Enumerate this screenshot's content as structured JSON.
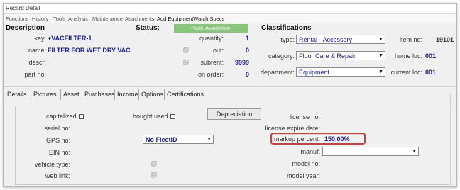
{
  "window": {
    "title": "Record Detail"
  },
  "menu": [
    "Functions",
    "History",
    "Tools",
    "Analysis",
    "Maintenance",
    "Attachments",
    "Add EquipmentWatch Specs"
  ],
  "description": {
    "section_title": "Description",
    "key_label": "key:",
    "key_value": "+VACFILTER-1",
    "name_label": "name:",
    "name_value": "FILTER FOR WET DRY VAC",
    "descr_label": "descr:",
    "descr_value": "",
    "partno_label": "part no:",
    "partno_value": ""
  },
  "status": {
    "section_title": "Status:",
    "badge": "Bulk Available",
    "quantity_label": "quantity:",
    "quantity_value": "1",
    "out_label": "out:",
    "out_value": "0",
    "subrent_label": "subrent:",
    "subrent_value": "9999",
    "onorder_label": "on order:",
    "onorder_value": "0"
  },
  "classifications": {
    "section_title": "Classifications",
    "type_label": "type:",
    "type_value": "Rental - Accessory",
    "category_label": "category:",
    "category_value": "Floor Care & Repair",
    "department_label": "department:",
    "department_value": "Equipment",
    "itemno_label": "item no:",
    "itemno_value": "19101",
    "homeloc_label": "home loc:",
    "homeloc_value": "001",
    "currentloc_label": "current loc:",
    "currentloc_value": "001"
  },
  "tabs": [
    "Details",
    "Pictures",
    "Asset",
    "Purchases",
    "Income",
    "Options",
    "Certifications"
  ],
  "asset": {
    "capitalized_label": "capitalized",
    "bought_used_label": "bought used",
    "depreciation_button": "Depreciation",
    "serial_label": "serial no:",
    "gps_label": "GPS no:",
    "fleet_value": "No FleetID",
    "ein_label": "EIN no:",
    "vehicle_label": "vehicle type:",
    "weblink_label": "web link:",
    "license_label": "license no:",
    "license_expire_label": "license expire date:",
    "markup_label": "markup percent:",
    "markup_value": "150.00%",
    "manuf_label": "manuf:",
    "model_label": "model no:",
    "model_year_label": "model year:"
  },
  "colors": {
    "accent": "#1a1aa8",
    "status_green": "#88c67a",
    "highlight_red": "#d63b3b"
  }
}
